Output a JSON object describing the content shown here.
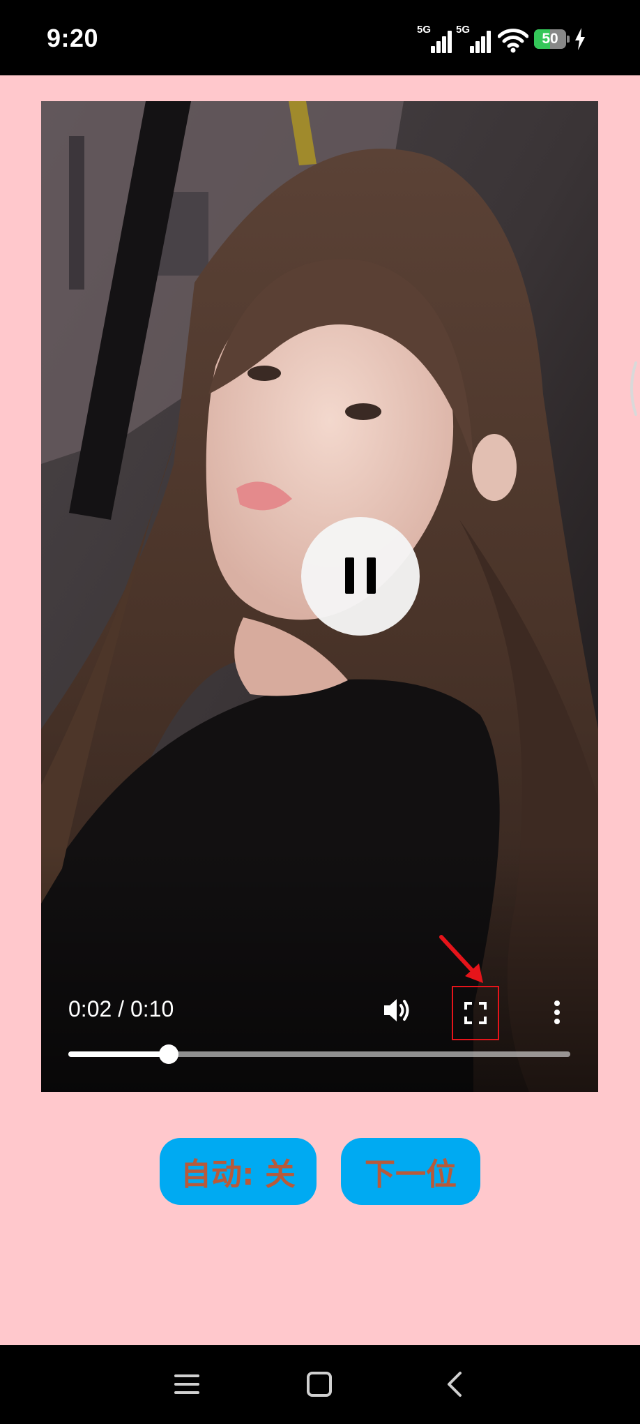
{
  "status_bar": {
    "time": "9:20",
    "network_1": "5G",
    "network_2": "5G",
    "battery_level": "50",
    "battery_fraction": 0.5,
    "charging": true,
    "icons": [
      "signal-5g-icon",
      "signal-5g-icon",
      "wifi-icon",
      "battery-icon",
      "charging-bolt-icon"
    ]
  },
  "video_player": {
    "state": "playing",
    "current_time": "0:02",
    "separator": " / ",
    "duration": "0:10",
    "progress_fraction": 0.2,
    "controls": [
      "pause-icon",
      "volume-icon",
      "fullscreen-icon",
      "more-options-icon"
    ],
    "highlight_color": "#e6141a"
  },
  "buttons": {
    "auto_label": "自动: 关",
    "next_label": "下一位"
  },
  "nav_bar": {
    "icons": [
      "menu-icon",
      "home-icon",
      "back-icon"
    ]
  },
  "colors": {
    "page_background": "#ffc8cc",
    "button_background": "#00aaf2",
    "button_text": "#b85a3a"
  }
}
